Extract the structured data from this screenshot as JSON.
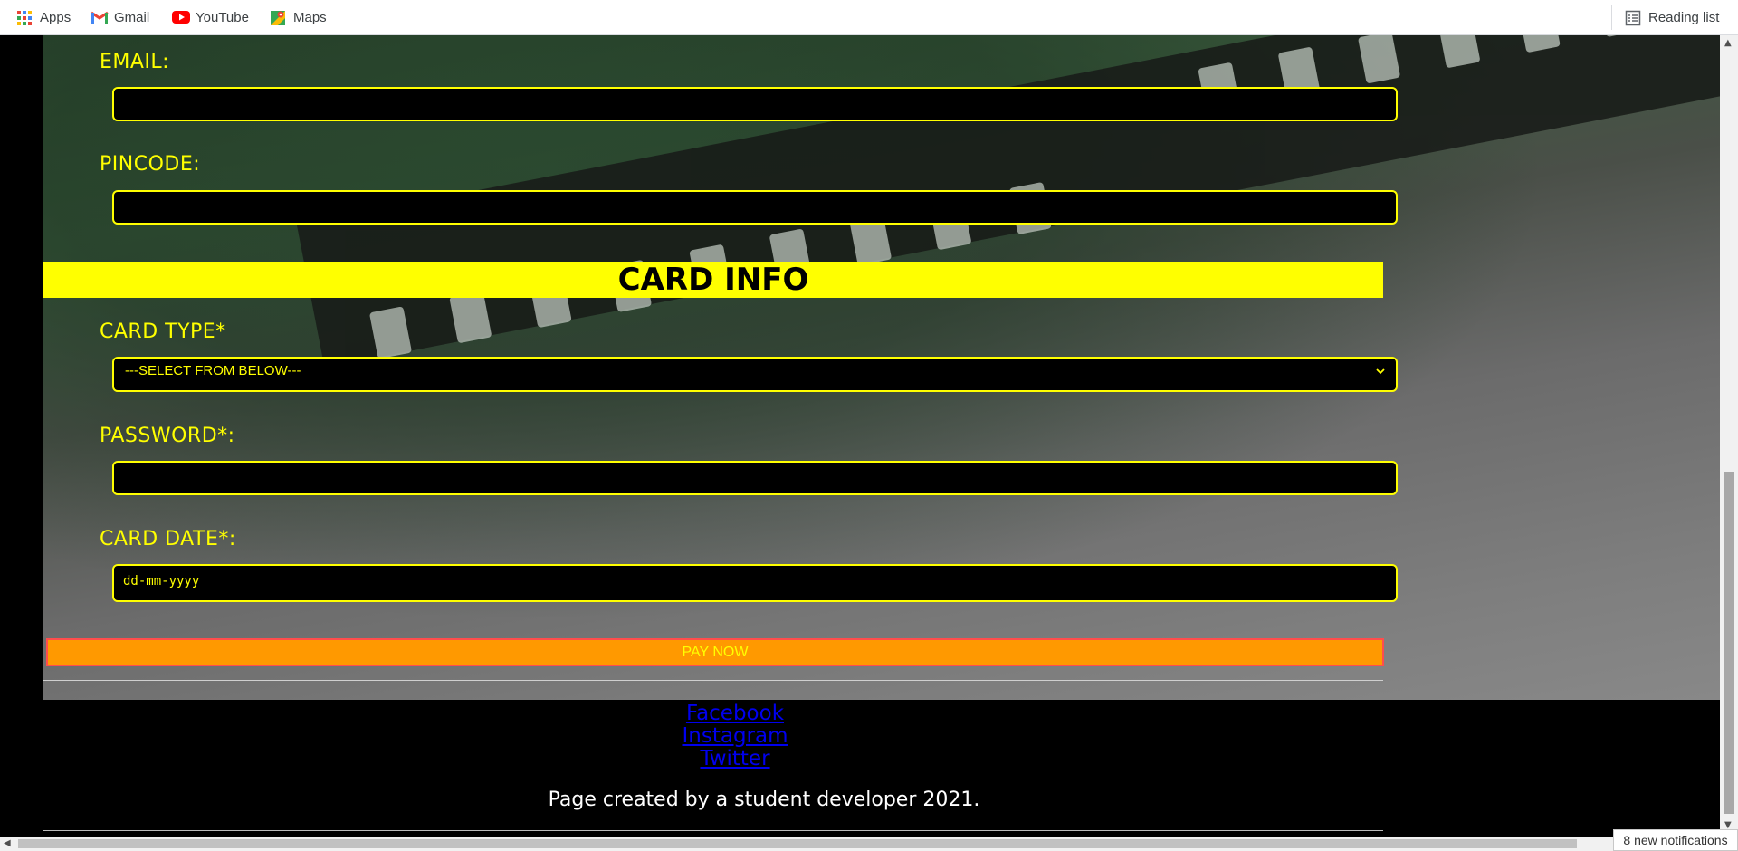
{
  "bookmarks": {
    "items": [
      {
        "label": "Apps",
        "icon": "apps-grid-icon"
      },
      {
        "label": "Gmail",
        "icon": "gmail-icon"
      },
      {
        "label": "YouTube",
        "icon": "youtube-icon"
      },
      {
        "label": "Maps",
        "icon": "maps-icon"
      }
    ],
    "reading_list": "Reading list"
  },
  "form": {
    "email_label": "EMAIL:",
    "pincode_label": "PINCODE:",
    "card_section_title": "CARD INFO",
    "card_type_label": "CARD TYPE*",
    "card_type_selected": "---SELECT FROM BELOW---",
    "password_label": "PASSWORD*:",
    "card_date_label": "CARD DATE*:",
    "card_date_placeholder": "dd-mm-yyyy",
    "pay_button": "PAY NOW"
  },
  "footer": {
    "links": [
      "Facebook",
      "Instagram",
      "Twitter"
    ],
    "credit": "Page created by a student developer 2021."
  },
  "status": {
    "notifications": "8 new notifications"
  },
  "colors": {
    "accent": "#ffff00",
    "button": "#ff9900",
    "link": "#0000ee"
  }
}
